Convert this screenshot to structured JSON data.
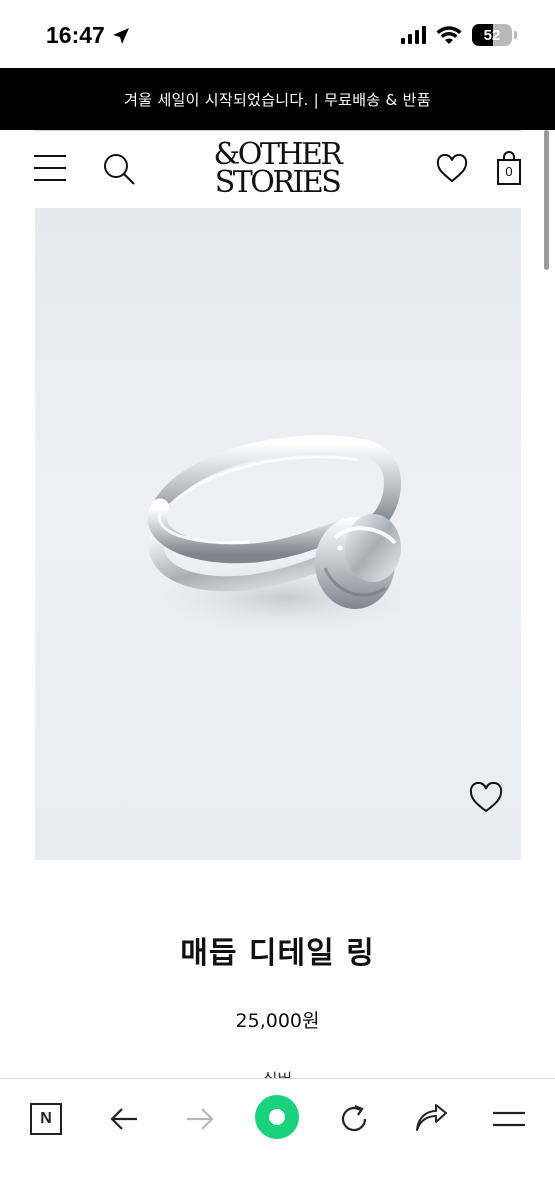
{
  "status_bar": {
    "time": "16:47",
    "battery_level": "52",
    "location_icon": "location-arrow-icon",
    "signal_icon": "cellular-signal-icon",
    "wifi_icon": "wifi-icon"
  },
  "promo_banner": {
    "text": "겨울 세일이 시작되었습니다. | 무료배송 & 반품"
  },
  "header": {
    "logo_line1": "&OTHER",
    "logo_line2": "STORIES",
    "bag_count": "0",
    "icons": [
      "menu-icon",
      "search-icon",
      "heart-icon",
      "shopping-bag-icon"
    ]
  },
  "product": {
    "title": "매듭 디테일 링",
    "price": "25,000원",
    "color": "실버",
    "image_icon": "knot-ring-image"
  },
  "browser_toolbar": {
    "n_label": "N",
    "icons": [
      "naver-n-icon",
      "back-arrow-icon",
      "forward-arrow-icon",
      "home-green-icon",
      "reload-icon",
      "share-icon",
      "menu-icon"
    ]
  },
  "colors": {
    "promo_bg": "#000000",
    "accent_green": "#19d27b",
    "image_bg": "#e8ebf0"
  }
}
